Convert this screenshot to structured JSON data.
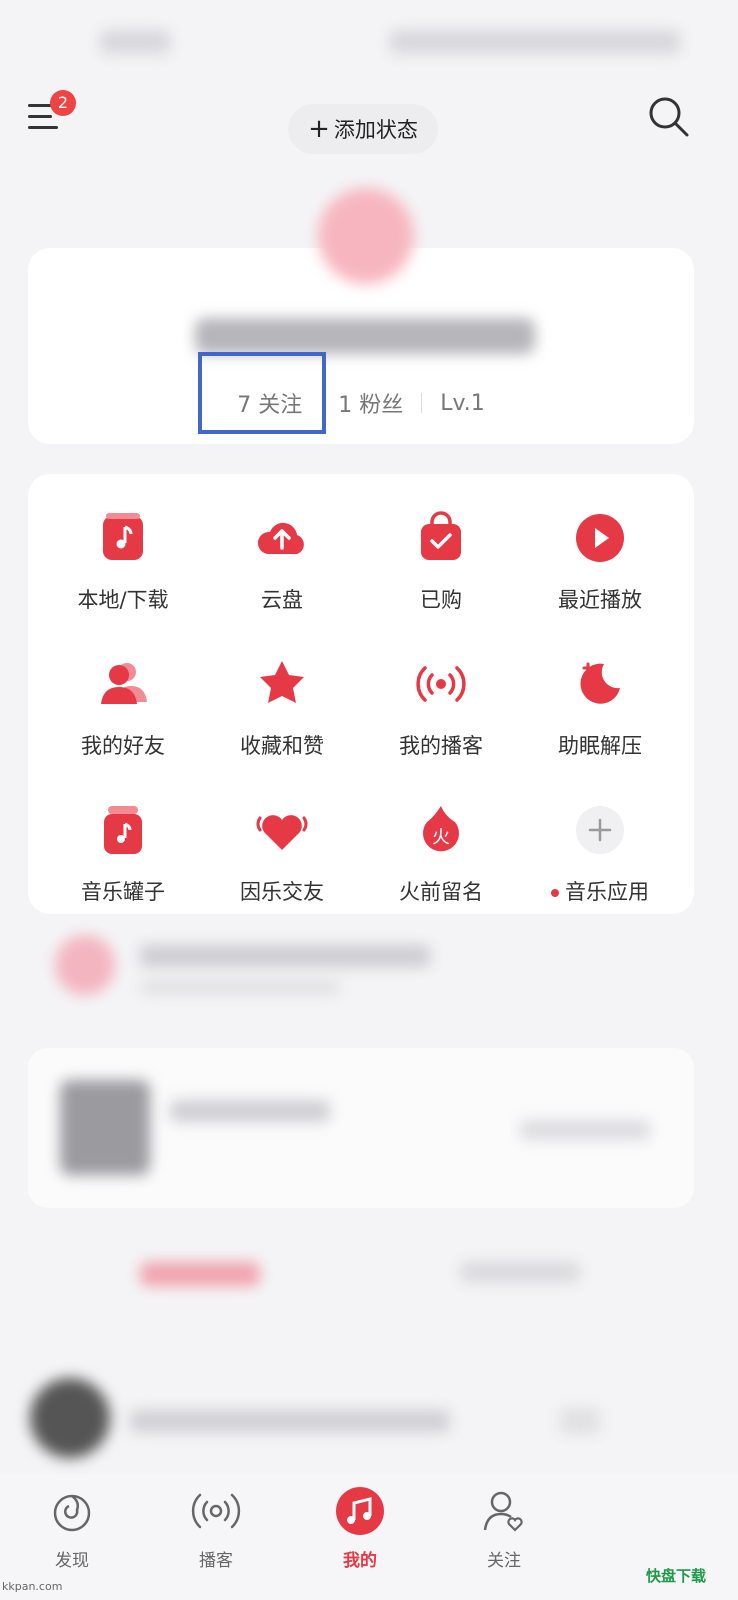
{
  "top_bar": {
    "menu_badge": "2",
    "add_status_label": "添加状态"
  },
  "profile": {
    "following": "7 关注",
    "followers": "1 粉丝",
    "level": "Lv.1"
  },
  "grid": [
    {
      "label": "本地/下载",
      "icon": "music-file-icon"
    },
    {
      "label": "云盘",
      "icon": "cloud-upload-icon"
    },
    {
      "label": "已购",
      "icon": "shopping-bag-icon"
    },
    {
      "label": "最近播放",
      "icon": "play-circle-icon"
    },
    {
      "label": "我的好友",
      "icon": "friends-icon"
    },
    {
      "label": "收藏和赞",
      "icon": "star-icon"
    },
    {
      "label": "我的播客",
      "icon": "broadcast-icon"
    },
    {
      "label": "助眠解压",
      "icon": "moon-icon"
    },
    {
      "label": "音乐罐子",
      "icon": "music-jar-icon"
    },
    {
      "label": "因乐交友",
      "icon": "heart-icon"
    },
    {
      "label": "火前留名",
      "icon": "fire-icon"
    },
    {
      "label": "音乐应用",
      "icon": "plus-circle-icon"
    }
  ],
  "tabbar": [
    {
      "label": "发现",
      "icon": "discover-icon"
    },
    {
      "label": "播客",
      "icon": "podcast-icon"
    },
    {
      "label": "我的",
      "icon": "music-note-icon",
      "active": true
    },
    {
      "label": "关注",
      "icon": "follow-icon"
    }
  ],
  "watermark": {
    "left": "kkpan.com",
    "right": "快盘下载"
  },
  "colors": {
    "accent": "#e63946",
    "highlight_box": "#3f68c8"
  }
}
